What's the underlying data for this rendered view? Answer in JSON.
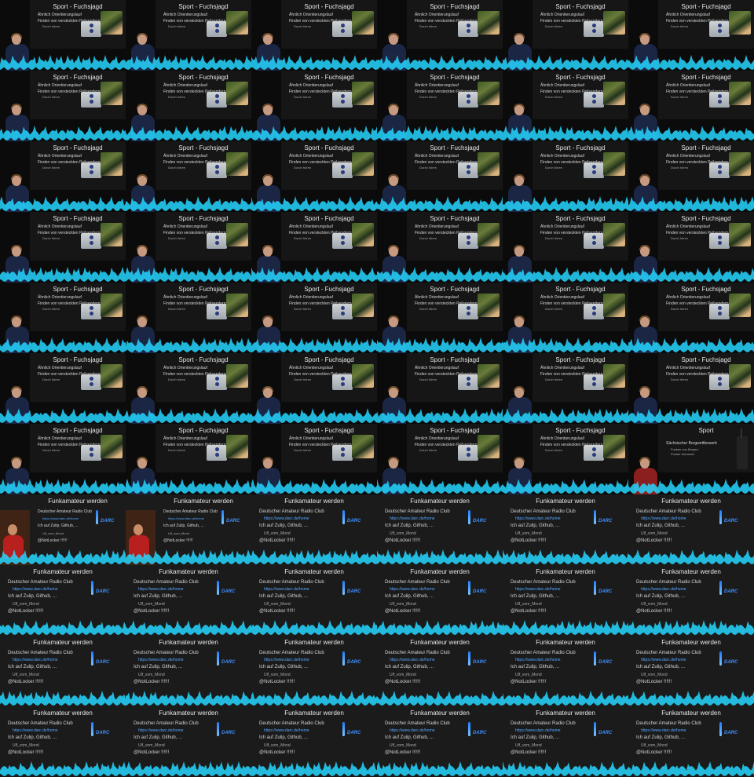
{
  "sport_tile": {
    "title": "Sport - Fuchsjagd",
    "bullet1": "Ähnlich Orientierungslauf",
    "bullet2": "Finden von versteckten Peilsendern",
    "sub": "Durch hören"
  },
  "sport_intro": {
    "title": "Sport",
    "bullet1": "Sächsischer Bergwettbewerb",
    "sub1": "Funken von Bergen",
    "sub2": "Punkte Sammeln"
  },
  "funk_tile": {
    "title": "Funkamateur werden",
    "bullet1": "Deutscher Amateur Radio Club",
    "sub1": "https://www.darc.de/home",
    "bullet2": "Ich auf Zulip, Github, ...",
    "sub2": "Ulf_vom_Mond",
    "bullet3": "@NotLocker !!!!!!",
    "logo": "DARC"
  },
  "layout_plan": {
    "sport_tiles": 41,
    "sport_intro_tiles": 1,
    "funk_with_speaker": 2,
    "funk_plain": 22
  },
  "colors": {
    "wave": "#24d6ff",
    "link": "#53a7ff",
    "darc": "#3f8fff"
  }
}
